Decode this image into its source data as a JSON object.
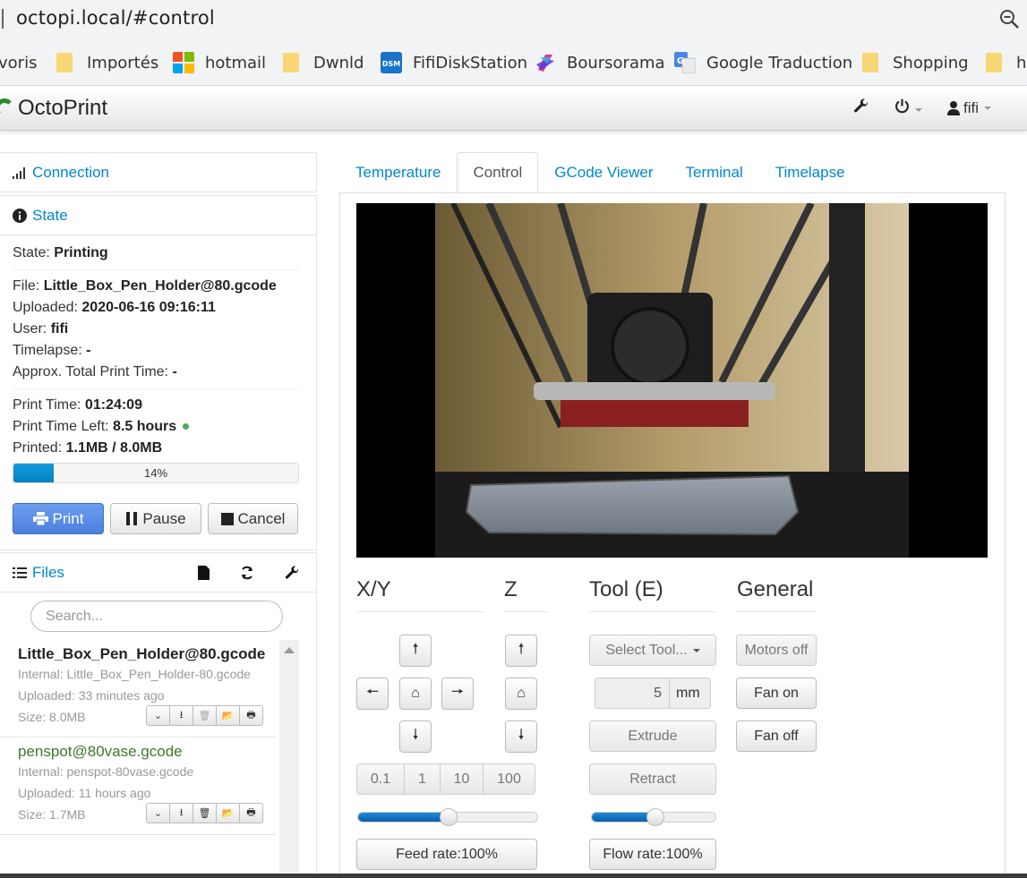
{
  "browser": {
    "url": "octopi.local/#control",
    "bookmarks": [
      {
        "label": "voris",
        "icon": "none"
      },
      {
        "label": "Importés",
        "icon": "folder-icon"
      },
      {
        "label": "hotmail",
        "icon": "microsoft-icon"
      },
      {
        "label": "Dwnld",
        "icon": "folder-icon"
      },
      {
        "label": "FifiDiskStation",
        "icon": "dsm-icon"
      },
      {
        "label": "Boursorama",
        "icon": "boursorama-icon"
      },
      {
        "label": "Google Traduction",
        "icon": "google-translate-icon"
      },
      {
        "label": "Shopping",
        "icon": "folder-icon"
      },
      {
        "label": "h",
        "icon": "folder-icon"
      }
    ]
  },
  "navbar": {
    "brand": "OctoPrint",
    "user": "fifi",
    "icons": [
      "wrench-icon",
      "power-icon",
      "user-icon"
    ]
  },
  "sidebar": {
    "connection": {
      "title": "Connection"
    },
    "state": {
      "title": "State",
      "state_label": "State:",
      "state_value": "Printing",
      "file_label": "File:",
      "file_value": "Little_Box_Pen_Holder@80.gcode",
      "uploaded_label": "Uploaded:",
      "uploaded_value": "2020-06-16 09:16:11",
      "user_label": "User:",
      "user_value": "fifi",
      "timelapse_label": "Timelapse:",
      "timelapse_value": "-",
      "approx_label": "Approx. Total Print Time:",
      "approx_value": "-",
      "print_time_label": "Print Time:",
      "print_time_value": "01:24:09",
      "time_left_label": "Print Time Left:",
      "time_left_value": "8.5 hours",
      "printed_label": "Printed:",
      "printed_value": "1.1MB / 8.0MB",
      "progress_percent": 14,
      "progress_text": "14%",
      "buttons": {
        "print": "Print",
        "pause": "Pause",
        "cancel": "Cancel"
      }
    },
    "files": {
      "title": "Files",
      "search_placeholder": "Search...",
      "items": [
        {
          "name": "Little_Box_Pen_Holder@80.gcode",
          "internal": "Internal: Little_Box_Pen_Holder-80.gcode",
          "uploaded": "Uploaded: 33 minutes ago",
          "size": "Size: 8.0MB",
          "selected": true
        },
        {
          "name": "penspot@80vase.gcode",
          "internal": "Internal: penspot-80vase.gcode",
          "uploaded": "Uploaded: 11 hours ago",
          "size": "Size: 1.7MB",
          "selected": false
        }
      ]
    }
  },
  "tabs": [
    "Temperature",
    "Control",
    "GCode Viewer",
    "Terminal",
    "Timelapse"
  ],
  "active_tab": "Control",
  "control": {
    "groups": {
      "xy": "X/Y",
      "z": "Z",
      "tool": "Tool (E)",
      "general": "General"
    },
    "step_sizes": [
      "0.1",
      "1",
      "10",
      "100"
    ],
    "select_tool": "Select Tool...",
    "extrude_amount": "5",
    "extrude_unit": "mm",
    "extrude": "Extrude",
    "retract": "Retract",
    "motors_off": "Motors off",
    "fan_on": "Fan on",
    "fan_off": "Fan off",
    "feed_rate_label": "Feed rate:100%",
    "flow_rate_label": "Flow rate:100%",
    "feed_rate_percent": 100,
    "flow_rate_percent": 100
  }
}
